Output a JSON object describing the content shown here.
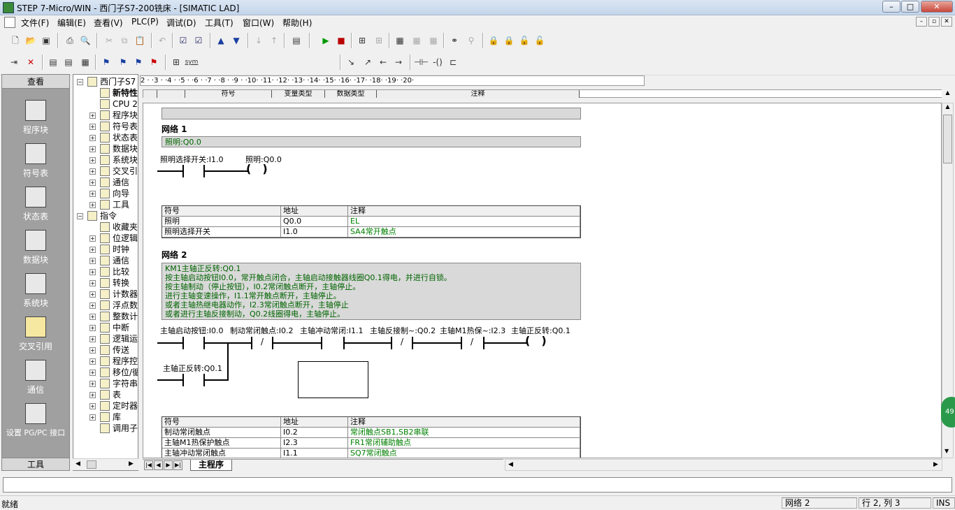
{
  "window": {
    "title": "STEP 7-Micro/WIN - 西门子S7-200铣床 - [SIMATIC LAD]",
    "controls": {
      "minimize": "–",
      "maximize": "□",
      "close": "✕"
    }
  },
  "menu": [
    "文件(F)",
    "编辑(E)",
    "查看(V)",
    "PLC(P)",
    "调试(D)",
    "工具(T)",
    "窗口(W)",
    "帮助(H)"
  ],
  "mdi_controls": [
    "–",
    "▫",
    "✕"
  ],
  "navbar": {
    "header": "查看",
    "footer": "工具",
    "items": [
      {
        "label": "程序块",
        "icon": "program-block-icon"
      },
      {
        "label": "符号表",
        "icon": "symbol-table-icon"
      },
      {
        "label": "状态表",
        "icon": "status-table-icon"
      },
      {
        "label": "数据块",
        "icon": "data-block-icon"
      },
      {
        "label": "系统块",
        "icon": "system-block-icon"
      },
      {
        "label": "交叉引用",
        "icon": "cross-reference-icon"
      },
      {
        "label": "通信",
        "icon": "communication-icon"
      },
      {
        "label": "设置 PG/PC 接口",
        "icon": "pgpc-interface-icon"
      }
    ]
  },
  "tree": {
    "nodes": [
      {
        "label": "西门子S7",
        "level": 0,
        "toggle": "−"
      },
      {
        "label": "新特性",
        "level": 1,
        "toggle": "",
        "bold": true
      },
      {
        "label": "CPU 2",
        "level": 1,
        "toggle": ""
      },
      {
        "label": "程序块",
        "level": 1,
        "toggle": "+"
      },
      {
        "label": "符号表",
        "level": 1,
        "toggle": "+"
      },
      {
        "label": "状态表",
        "level": 1,
        "toggle": "+"
      },
      {
        "label": "数据块",
        "level": 1,
        "toggle": "+"
      },
      {
        "label": "系统块",
        "level": 1,
        "toggle": "+"
      },
      {
        "label": "交叉引",
        "level": 1,
        "toggle": "+"
      },
      {
        "label": "通信",
        "level": 1,
        "toggle": "+"
      },
      {
        "label": "向导",
        "level": 1,
        "toggle": "+"
      },
      {
        "label": "工具",
        "level": 1,
        "toggle": "+"
      },
      {
        "label": "指令",
        "level": 0,
        "toggle": "−"
      },
      {
        "label": "收藏夹",
        "level": 1,
        "toggle": ""
      },
      {
        "label": "位逻辑",
        "level": 1,
        "toggle": "+"
      },
      {
        "label": "时钟",
        "level": 1,
        "toggle": "+"
      },
      {
        "label": "通信",
        "level": 1,
        "toggle": "+"
      },
      {
        "label": "比较",
        "level": 1,
        "toggle": "+"
      },
      {
        "label": "转换",
        "level": 1,
        "toggle": "+"
      },
      {
        "label": "计数器",
        "level": 1,
        "toggle": "+"
      },
      {
        "label": "浮点数",
        "level": 1,
        "toggle": "+"
      },
      {
        "label": "整数计",
        "level": 1,
        "toggle": "+"
      },
      {
        "label": "中断",
        "level": 1,
        "toggle": "+"
      },
      {
        "label": "逻辑运",
        "level": 1,
        "toggle": "+"
      },
      {
        "label": "传送",
        "level": 1,
        "toggle": "+"
      },
      {
        "label": "程序控",
        "level": 1,
        "toggle": "+"
      },
      {
        "label": "移位/循",
        "level": 1,
        "toggle": "+"
      },
      {
        "label": "字符串",
        "level": 1,
        "toggle": "+"
      },
      {
        "label": "表",
        "level": 1,
        "toggle": "+"
      },
      {
        "label": "定时器",
        "level": 1,
        "toggle": "+"
      },
      {
        "label": "库",
        "level": 1,
        "toggle": "+"
      },
      {
        "label": "调用子",
        "level": 1,
        "toggle": ""
      }
    ]
  },
  "ruler": "2 · ·3 · ·4 · ·5 · ·6 · ·7 · ·8 · ·9 · ·10· ·11· ·12· ·13· ·14· ·15· ·16· ·17· ·18· ·19· ·20·",
  "symbol_header": {
    "symbol": "符号",
    "var_type": "变量类型",
    "data_type": "数据类型",
    "comment": "注释"
  },
  "networks": [
    {
      "label": "网络 1",
      "comment": [
        "照明:Q0.0"
      ],
      "contact": "照明选择开关:I1.0",
      "coil_name": "照明:Q0.0",
      "table": {
        "headers": [
          "符号",
          "地址",
          "注释"
        ],
        "rows": [
          [
            "照明",
            "Q0.0",
            "EL"
          ],
          [
            "照明选择开关",
            "I1.0",
            "SA4常开触点"
          ]
        ]
      }
    },
    {
      "label": "网络 2",
      "comment": [
        "KM1主轴正反转:Q0.1",
        "按主轴启动按钮I0.0，常开触点闭合，主轴启动接触器线圈Q0.1得电，并进行自锁。",
        "按主轴制动（停止按钮），I0.2常闭触点断开，主轴停止。",
        "进行主轴变速操作，I1.1常开触点断开，主轴停止。",
        "或者主轴热继电器动作，I2.3常闭触点断开，主轴停止",
        "或者进行主轴反接制动，Q0.2线圈得电，主轴停止。"
      ],
      "contacts": [
        "主轴启动按钮:I0.0",
        "制动常闭触点:I0.2",
        "主轴冲动常闭:I1.1",
        "主轴反接制~:Q0.2",
        "主轴M1热保~:I2.3"
      ],
      "coil_name": "主轴正反转:Q0.1",
      "parallel_contact": "主轴正反转:Q0.1",
      "table": {
        "headers": [
          "符号",
          "地址",
          "注释"
        ],
        "rows": [
          [
            "制动常闭触点",
            "I0.2",
            "常闭触点SB1,SB2串联"
          ],
          [
            "主轴M1热保护触点",
            "I2.3",
            "FR1常闭辅助触点"
          ],
          [
            "主轴冲动常闭触点",
            "I1.1",
            "SQ7常闭触点"
          ]
        ]
      }
    }
  ],
  "tabs": {
    "main": "主程序"
  },
  "status": {
    "ready": "就绪",
    "network": "网络 2",
    "position": "行 2, 列 3",
    "mode": "INS"
  },
  "badge": "49"
}
